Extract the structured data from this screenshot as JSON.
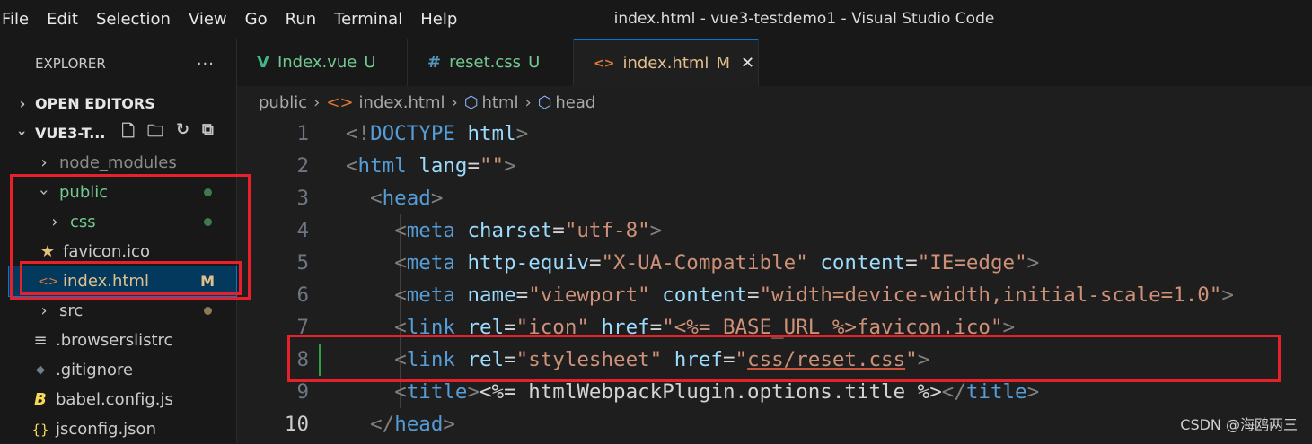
{
  "menu": [
    "File",
    "Edit",
    "Selection",
    "View",
    "Go",
    "Run",
    "Terminal",
    "Help"
  ],
  "window_title": "index.html - vue3-testdemo1 - Visual Studio Code",
  "sidebar": {
    "header": "EXPLORER",
    "more": "···",
    "open_editors": "OPEN EDITORS",
    "project": "VUE3-T...",
    "items": [
      {
        "label": "node_modules",
        "type": "folder",
        "status": "",
        "color": "#8c8c8c"
      },
      {
        "label": "public",
        "type": "folder-open",
        "status": "dot",
        "color": "#73c991"
      },
      {
        "label": "css",
        "type": "folder",
        "status": "dot",
        "color": "#73c991"
      },
      {
        "label": "favicon.ico",
        "type": "file",
        "status": "",
        "color": "#cccccc"
      },
      {
        "label": "index.html",
        "type": "file",
        "status": "M",
        "color": "#e2c08d"
      },
      {
        "label": "src",
        "type": "folder",
        "status": "dot-brown",
        "color": "#cccccc"
      },
      {
        "label": ".browserslistrc",
        "type": "file",
        "status": "",
        "color": "#cccccc"
      },
      {
        "label": ".gitignore",
        "type": "file",
        "status": "",
        "color": "#cccccc"
      },
      {
        "label": "babel.config.js",
        "type": "file",
        "status": "",
        "color": "#cccccc"
      },
      {
        "label": "jsconfig.json",
        "type": "file",
        "status": "",
        "color": "#cccccc"
      }
    ]
  },
  "tabs": [
    {
      "label": "Index.vue",
      "badge": "U",
      "icon": "V",
      "icon_color": "#41b883",
      "label_color": "#73c991"
    },
    {
      "label": "reset.css",
      "badge": "U",
      "icon": "#",
      "icon_color": "#519aba",
      "label_color": "#73c991"
    },
    {
      "label": "index.html",
      "badge": "M",
      "icon": "<>",
      "icon_color": "#e37933",
      "label_color": "#e2c08d",
      "close": "✕"
    }
  ],
  "breadcrumb": [
    "public",
    "index.html",
    "html",
    "head"
  ],
  "code_lines": [
    {
      "n": "1",
      "html": "<span class='t'>&lt;!</span><span class='tg'>DOCTYPE</span> <span class='at'>html</span><span class='t'>&gt;</span>"
    },
    {
      "n": "2",
      "html": "<span class='t'>&lt;</span><span class='tg'>html</span> <span class='at'>lang</span><span class='tx'>=</span><span class='st'>\"\"</span><span class='t'>&gt;</span>"
    },
    {
      "n": "3",
      "html": "  <span class='t'>&lt;</span><span class='tg'>head</span><span class='t'>&gt;</span>"
    },
    {
      "n": "4",
      "html": "    <span class='t'>&lt;</span><span class='tg'>meta</span> <span class='at'>charset</span><span class='tx'>=</span><span class='st'>\"utf-8\"</span><span class='t'>&gt;</span>"
    },
    {
      "n": "5",
      "html": "    <span class='t'>&lt;</span><span class='tg'>meta</span> <span class='at'>http-equiv</span><span class='tx'>=</span><span class='st'>\"X-UA-Compatible\"</span> <span class='at'>content</span><span class='tx'>=</span><span class='st'>\"IE=edge\"</span><span class='t'>&gt;</span>"
    },
    {
      "n": "6",
      "html": "    <span class='t'>&lt;</span><span class='tg'>meta</span> <span class='at'>name</span><span class='tx'>=</span><span class='st'>\"viewport\"</span> <span class='at'>content</span><span class='tx'>=</span><span class='st'>\"width=device-width,initial-scale=1.0\"</span><span class='t'>&gt;</span>"
    },
    {
      "n": "7",
      "html": "    <span class='t'>&lt;</span><span class='tg'>link</span> <span class='at'>rel</span><span class='tx'>=</span><span class='st'>\"icon\"</span> <span class='at'>href</span><span class='tx'>=</span><span class='st ul'>\"&lt;%= BASE_URL %&gt;favicon.ico\"</span><span class='t'>&gt;</span>"
    },
    {
      "n": "8",
      "html": "    <span class='t'>&lt;</span><span class='tg'>link</span> <span class='at'>rel</span><span class='tx'>=</span><span class='st'>\"stylesheet\"</span> <span class='at'>href</span><span class='tx'>=</span><span class='st'>\"<span class='ul'>css/reset.css</span>\"</span><span class='t'>&gt;</span>"
    },
    {
      "n": "9",
      "html": "    <span class='t'>&lt;</span><span class='tg'>title</span><span class='t'>&gt;</span><span class='tx'>&lt;%= htmlWebpackPlugin.options.title %&gt;</span><span class='t'>&lt;/</span><span class='tg'>title</span><span class='t'>&gt;</span>"
    },
    {
      "n": "10",
      "html": "  <span class='t'>&lt;/</span><span class='tg'>head</span><span class='t'>&gt;</span>"
    }
  ],
  "current_line": "10",
  "watermark": "CSDN @海鸥两三"
}
